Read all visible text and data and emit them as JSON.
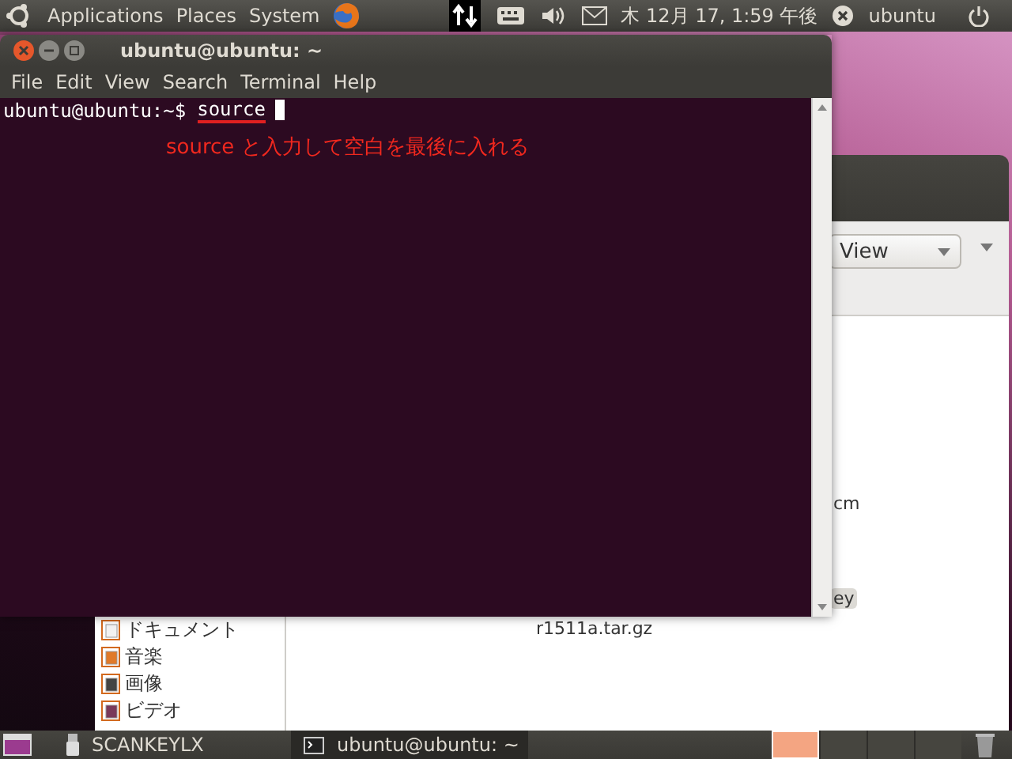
{
  "top_panel": {
    "menus": [
      "Applications",
      "Places",
      "System"
    ],
    "clock": "木 12月 17, 1:59 午後",
    "user": "ubuntu"
  },
  "terminal": {
    "title": "ubuntu@ubuntu: ~",
    "menu": [
      "File",
      "Edit",
      "View",
      "Search",
      "Terminal",
      "Help"
    ],
    "prompt": "ubuntu@ubuntu:~$",
    "command": "source",
    "annotation": "source と入力して空白を最後に入れる"
  },
  "file_manager": {
    "view_button": "View",
    "sidebar": [
      {
        "label": "ドキュメント",
        "kind": "documents"
      },
      {
        "label": "音楽",
        "kind": "music"
      },
      {
        "label": "画像",
        "kind": "pictures"
      },
      {
        "label": "ビデオ",
        "kind": "videos"
      }
    ],
    "files": [
      {
        "name": "cm",
        "selected": false
      },
      {
        "name": "ey",
        "selected": true
      },
      {
        "name": "r1511a.tar.gz",
        "selected": false
      }
    ]
  },
  "taskbar": {
    "items": [
      {
        "label": "SCANKEYLX",
        "kind": "usb",
        "selected": false
      },
      {
        "label": "ubuntu@ubuntu: ~",
        "kind": "terminal",
        "selected": true
      }
    ],
    "workspaces": [
      {
        "selected": true
      },
      {
        "selected": false
      },
      {
        "selected": false
      },
      {
        "selected": false
      }
    ]
  }
}
